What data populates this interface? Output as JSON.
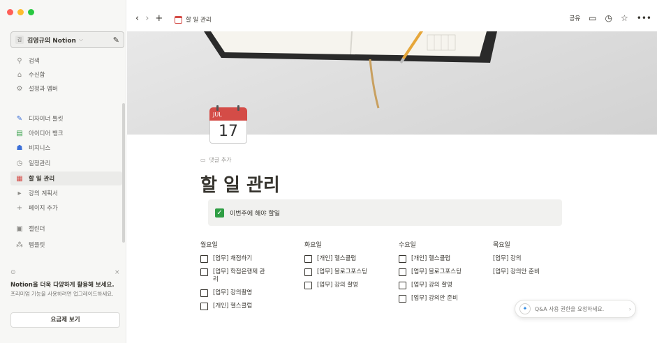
{
  "sidebar": {
    "workspace": {
      "avatar": "김",
      "name": "김영규의 Notion",
      "chevron_icon": "chevron-down-icon",
      "edit_icon": "compose-icon"
    },
    "top_items": [
      {
        "label": "검색",
        "icon": "search-icon"
      },
      {
        "label": "수신함",
        "icon": "inbox-icon"
      },
      {
        "label": "설정과 멤버",
        "icon": "gear-icon"
      }
    ],
    "pages": [
      {
        "label": "디자이너 툴킷",
        "icon": "pencil-icon"
      },
      {
        "label": "아이디어 뱅크",
        "icon": "books-icon"
      },
      {
        "label": "비지니스",
        "icon": "business-icon"
      },
      {
        "label": "일정관리",
        "icon": "clock-icon"
      },
      {
        "label": "할 일 관리",
        "icon": "calendar-icon",
        "active": true
      },
      {
        "label": "강의 계획서",
        "icon": "page-icon"
      },
      {
        "label": "페이지 추가",
        "icon": "plus-icon"
      }
    ],
    "bottom_items": [
      {
        "label": "캘린더",
        "icon": "calendar-outline-icon"
      },
      {
        "label": "템플릿",
        "icon": "template-icon"
      }
    ],
    "promo": {
      "icon": "lightning-icon",
      "close_icon": "close-icon",
      "title": "Notion을 더욱 다양하게 활용해 보세요.",
      "body": "프리미엄 기능을 사용하려면 업그레이드하세요.",
      "button": "요금제 보기"
    }
  },
  "topbar": {
    "back_icon": "chevron-left-icon",
    "forward_icon": "chevron-right-icon",
    "add_icon": "plus-icon",
    "breadcrumb": "할 일 관리",
    "share": "공유",
    "right_icons": [
      "comment-icon",
      "clock-icon",
      "star-icon",
      "more-icon"
    ]
  },
  "page": {
    "icon": {
      "month": "JUL",
      "day": "17"
    },
    "add_comment": "댓글 추가",
    "title": "할 일 관리",
    "callout": "이번주에 해야 할일",
    "columns": [
      {
        "heading": "월요일",
        "items": [
          {
            "text": "[업무] 채점하기",
            "checkbox": true
          },
          {
            "text": "[업무] 학점은행제 관리",
            "checkbox": true
          },
          {
            "text": "[업무] 강의촬영",
            "checkbox": true
          },
          {
            "text": "[개인] 헬스클럽",
            "checkbox": true
          }
        ]
      },
      {
        "heading": "화요일",
        "items": [
          {
            "text": "[개인] 헬스클럽",
            "checkbox": true
          },
          {
            "text": "[업무] 블로그포스팅",
            "checkbox": true
          },
          {
            "text": "[업무] 강의 촬영",
            "checkbox": true
          }
        ]
      },
      {
        "heading": "수요일",
        "items": [
          {
            "text": "[개인] 헬스클럽",
            "checkbox": true
          },
          {
            "text": "[업무] 블로그포스팅",
            "checkbox": true
          },
          {
            "text": "[업무] 강의 촬영",
            "checkbox": true
          },
          {
            "text": "[업무] 강의안 준비",
            "checkbox": true
          }
        ]
      },
      {
        "heading": "목요일",
        "items": [
          {
            "text": "[업무] 강의",
            "checkbox": false
          },
          {
            "text": "[업무] 강의안 준비",
            "checkbox": false
          }
        ]
      }
    ]
  },
  "qa_button": {
    "label": "Q&A 사용 권한을 요청하세요.",
    "icon": "sparkle-icon",
    "chevron_icon": "chevron-right-icon"
  },
  "colors": {
    "sidebar_bg": "#f7f7f5",
    "accent_red": "#d44c47",
    "check_green": "#2f9e44",
    "callout_bg": "#f1f1ef"
  }
}
